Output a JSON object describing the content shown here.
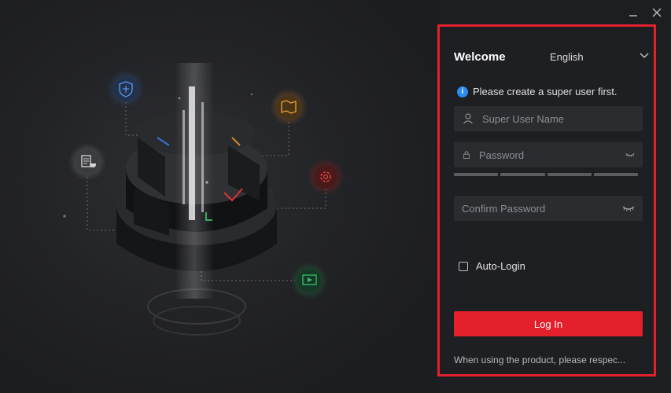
{
  "window": {
    "minimize_icon": "minimize-icon",
    "close_icon": "close-icon"
  },
  "login": {
    "welcome": "Welcome",
    "language": "English",
    "info_text": "Please create a super user first.",
    "username_placeholder": "Super User Name",
    "password_placeholder": "Password",
    "confirm_placeholder": "Confirm Password",
    "auto_login_label": "Auto-Login",
    "login_button": "Log In",
    "notice": "When using the product, please respec..."
  },
  "colors": {
    "accent": "#e3202c",
    "info": "#2d8cf0",
    "panel_border": "#e2202e"
  }
}
